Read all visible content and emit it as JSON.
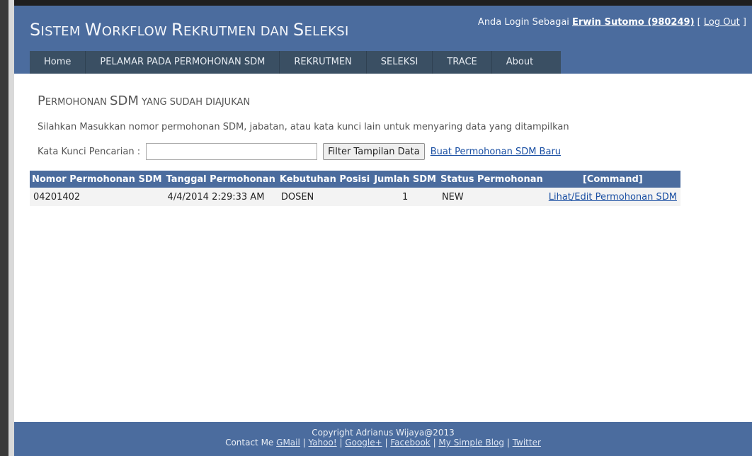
{
  "header": {
    "title": {
      "part1": "S",
      "part2": "istem ",
      "part3": "W",
      "part4": "orkflow ",
      "part5": "R",
      "part6": "ekrutmen ",
      "part7": "dan ",
      "part8": "S",
      "part9": "eleksi"
    },
    "login_prefix": "Anda Login Sebagai ",
    "user": "Erwin Sutomo (980249)",
    "logout_open": " [ ",
    "logout": "Log Out",
    "logout_close": " ]"
  },
  "menu": {
    "items": [
      "Home",
      "PELAMAR PADA PERMOHONAN SDM",
      "REKRUTMEN",
      "SELEKSI",
      "TRACE",
      "About"
    ]
  },
  "main": {
    "heading_p": "P",
    "heading_rest1": "ermohonan ",
    "heading_sdm": "SDM",
    "heading_rest2": " yang sudah diajukan",
    "instruction": "Silahkan Masukkan nomor permohonan SDM, jabatan, atau kata kunci lain untuk menyaring data yang ditampilkan",
    "search_label": "Kata Kunci Pencarian :",
    "search_value": "",
    "filter_button": "Filter Tampilan Data",
    "new_request_link": "Buat Permohonan SDM Baru"
  },
  "table": {
    "headers": [
      "Nomor Permohonan SDM",
      "Tanggal Permohonan",
      "Kebutuhan Posisi",
      "Jumlah SDM",
      "Status Permohonan",
      "[Command]"
    ],
    "rows": [
      [
        "04201402",
        "4/4/2014 2:29:33 AM",
        "DOSEN",
        "1",
        "NEW",
        "Lihat/Edit Permohonan SDM"
      ]
    ]
  },
  "footer": {
    "copyright": "Copyright Adrianus Wijaya@2013",
    "contact_prefix": "Contact Me ",
    "links": [
      "GMail",
      "Yahoo!",
      "Google+",
      "Facebook",
      "My Simple Blog",
      "Twitter"
    ],
    "separator": " | "
  },
  "colors": {
    "header_bg": "#4b6c9e",
    "menu_bg": "#3a4f63",
    "link": "#1a4fa3"
  }
}
